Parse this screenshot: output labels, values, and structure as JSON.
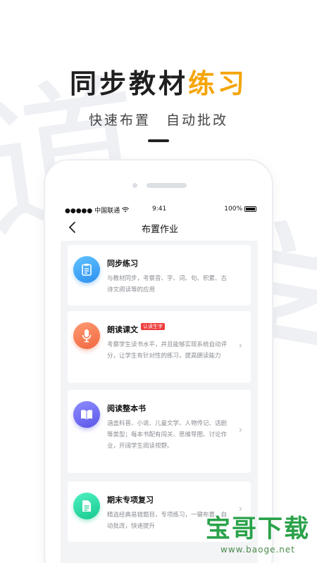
{
  "promo": {
    "headline_dark": "同步教材",
    "headline_accent": "练习",
    "sub_left": "快速布置",
    "sub_right": "自动批改"
  },
  "status_bar": {
    "carrier": "●●●●● 中国联通",
    "time": "9:41",
    "battery": "100%"
  },
  "nav": {
    "title": "布置作业"
  },
  "cards": [
    {
      "title": "同步练习",
      "desc": "与教材同步，考察音、字、词、句、积累、古诗文阅读等的应用",
      "icon": "document-icon",
      "color": "#2f90f0",
      "chevron": false
    },
    {
      "title": "朗读课文",
      "tag": "认读生字",
      "desc": "考察学生读书水平，并且能够实现系统自动评分，让学生有针对性的练习，提高朗读能力",
      "icon": "microphone-icon",
      "color": "#f1673f",
      "chevron": true
    },
    {
      "title": "阅读整本书",
      "desc": "涵盖科普、小说、儿童文学、人物传记、话剧等类型；每本书配有闯关、思维导图、讨论作业，开阔学生阅读视野。",
      "icon": "book-icon",
      "color": "#5b56e8",
      "chevron": true
    },
    {
      "title": "期末专项复习",
      "desc": "精选经典易错题目，专项练习，一键布置、自动批改，快速提升",
      "icon": "file-icon",
      "color": "#17c98f",
      "chevron": true
    }
  ],
  "watermark": {
    "main": "宝哥下载",
    "url": "www.baoge.net"
  }
}
